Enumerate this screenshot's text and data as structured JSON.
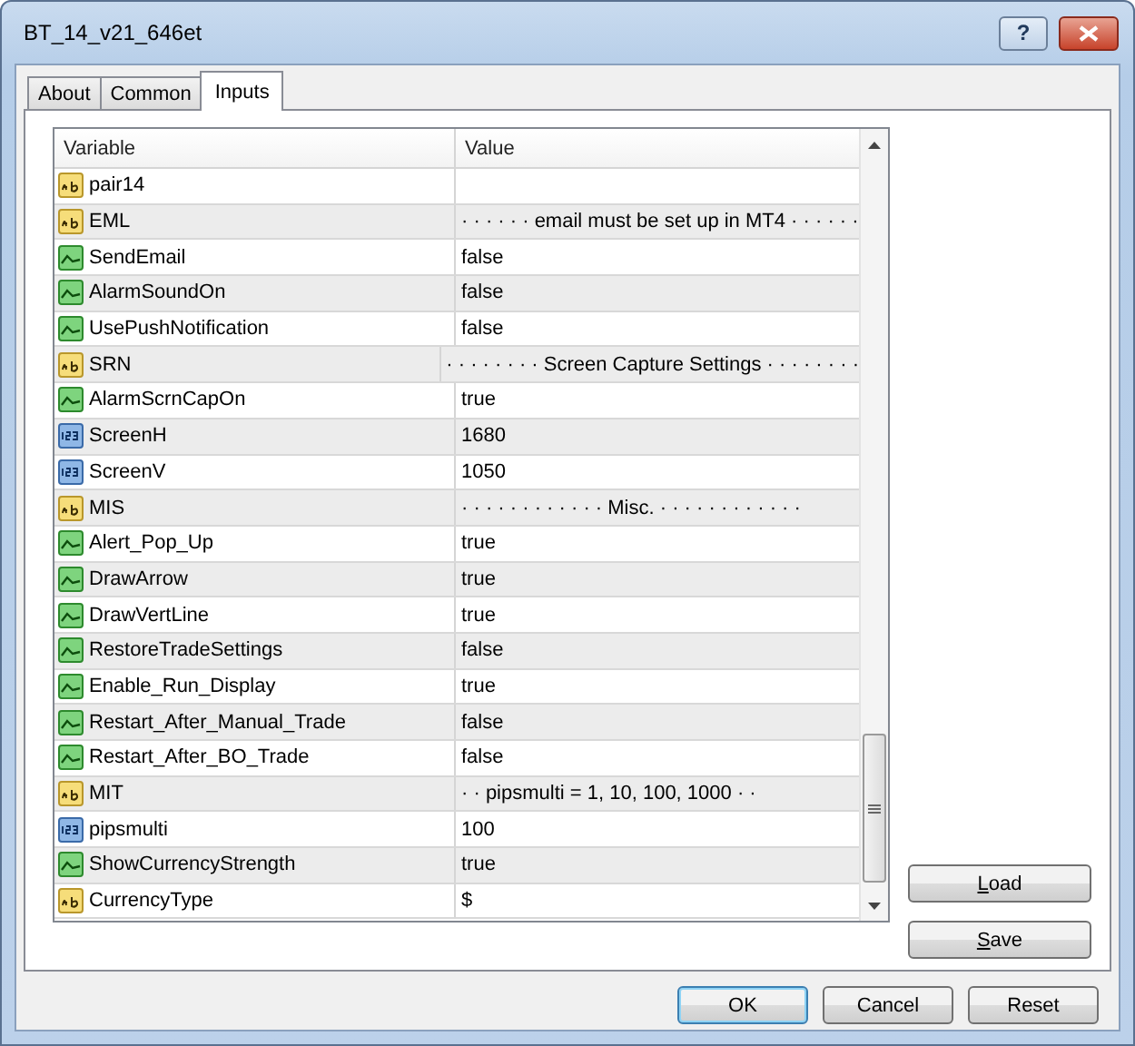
{
  "window": {
    "title": "BT_14_v21_646et",
    "title_buttons": [
      {
        "kind": "help",
        "label": "?"
      },
      {
        "kind": "close"
      }
    ]
  },
  "tabs": [
    {
      "label": "About",
      "selected": false
    },
    {
      "label": "Common",
      "selected": false
    },
    {
      "label": "Inputs",
      "selected": true
    }
  ],
  "table": {
    "columns": [
      "Variable",
      "Value"
    ],
    "rows": [
      {
        "kind": "string",
        "variable": "pair14",
        "value": ""
      },
      {
        "kind": "string",
        "variable": "EML",
        "value": "· · · · · · email must be set up in MT4  · · · · · ·"
      },
      {
        "kind": "bool",
        "variable": "SendEmail",
        "value": "false"
      },
      {
        "kind": "bool",
        "variable": "AlarmSoundOn",
        "value": "false"
      },
      {
        "kind": "bool",
        "variable": "UsePushNotification",
        "value": "false"
      },
      {
        "kind": "string",
        "variable": "SRN",
        "value": "· · · · · · · · Screen Capture Settings · · · · · · · ·"
      },
      {
        "kind": "bool",
        "variable": "AlarmScrnCapOn",
        "value": "true"
      },
      {
        "kind": "int",
        "variable": "ScreenH",
        "value": "1680"
      },
      {
        "kind": "int",
        "variable": "ScreenV",
        "value": "1050"
      },
      {
        "kind": "string",
        "variable": "MIS",
        "value": "· · · · · · · · · · · · Misc. · · · · · · · · · · · ·"
      },
      {
        "kind": "bool",
        "variable": "Alert_Pop_Up",
        "value": "true"
      },
      {
        "kind": "bool",
        "variable": "DrawArrow",
        "value": "true"
      },
      {
        "kind": "bool",
        "variable": "DrawVertLine",
        "value": "true"
      },
      {
        "kind": "bool",
        "variable": "RestoreTradeSettings",
        "value": "false"
      },
      {
        "kind": "bool",
        "variable": "Enable_Run_Display",
        "value": "true"
      },
      {
        "kind": "bool",
        "variable": "Restart_After_Manual_Trade",
        "value": "false"
      },
      {
        "kind": "bool",
        "variable": "Restart_After_BO_Trade",
        "value": "false"
      },
      {
        "kind": "string",
        "variable": "MIT",
        "value": "· · pipsmulti =  1, 10, 100, 1000 · ·"
      },
      {
        "kind": "int",
        "variable": "pipsmulti",
        "value": "100"
      },
      {
        "kind": "bool",
        "variable": "ShowCurrencyStrength",
        "value": "true"
      },
      {
        "kind": "string",
        "variable": "CurrencyType",
        "value": "$"
      }
    ]
  },
  "side_buttons": [
    {
      "label": "Load",
      "first_letter_underlined": true
    },
    {
      "label": "Save",
      "first_letter_underlined": true
    }
  ],
  "buttons": [
    {
      "label": "OK",
      "default": true
    },
    {
      "label": "Cancel",
      "default": false
    },
    {
      "label": "Reset",
      "default": false
    }
  ]
}
